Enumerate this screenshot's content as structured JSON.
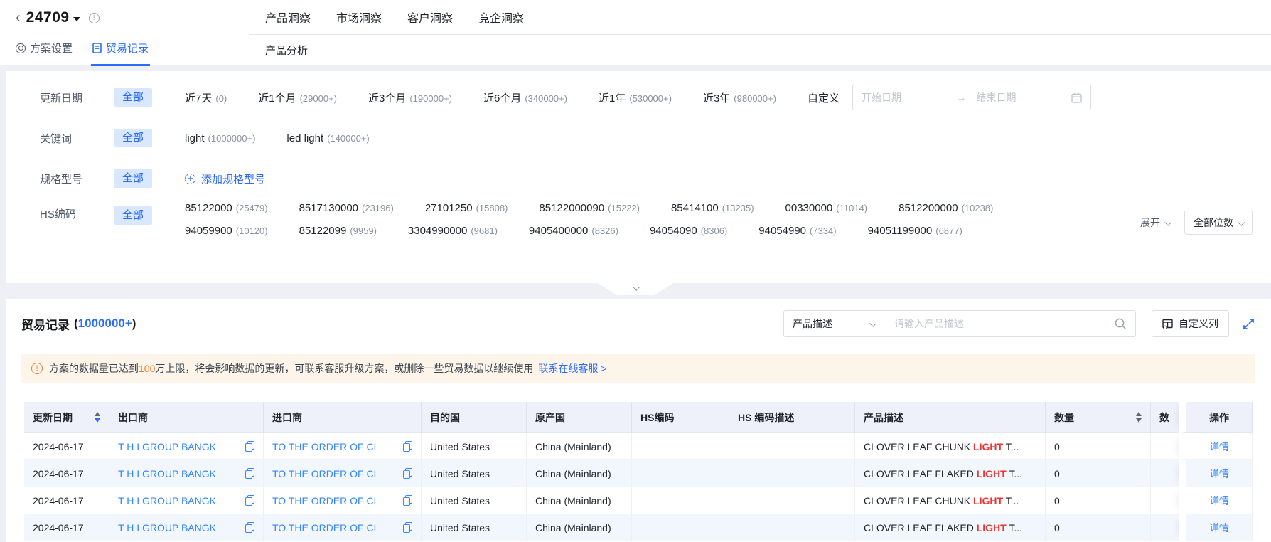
{
  "header": {
    "back_icon": "‹",
    "plan_id": "24709",
    "tabs": [
      {
        "label": "方案设置"
      },
      {
        "label": "贸易记录"
      }
    ],
    "nav": [
      "产品洞察",
      "市场洞察",
      "客户洞察",
      "竞企洞察"
    ],
    "subnav": "产品分析"
  },
  "filter": {
    "date": {
      "label": "更新日期",
      "all": "全部",
      "options": [
        {
          "name": "近7天",
          "count": "(0)"
        },
        {
          "name": "近1个月",
          "count": "(29000+)"
        },
        {
          "name": "近3个月",
          "count": "(190000+)"
        },
        {
          "name": "近6个月",
          "count": "(340000+)"
        },
        {
          "name": "近1年",
          "count": "(530000+)"
        },
        {
          "name": "近3年",
          "count": "(980000+)"
        }
      ],
      "custom": "自定义",
      "start_placeholder": "开始日期",
      "arrow": "→",
      "end_placeholder": "结束日期"
    },
    "keyword": {
      "label": "关键词",
      "all": "全部",
      "options": [
        {
          "name": "light",
          "count": "(1000000+)"
        },
        {
          "name": "led light",
          "count": "(140000+)"
        }
      ]
    },
    "spec": {
      "label": "规格型号",
      "all": "全部",
      "add": "添加规格型号"
    },
    "hs": {
      "label": "HS编码",
      "all": "全部",
      "line1": [
        {
          "name": "85122000",
          "count": "(25479)"
        },
        {
          "name": "8517130000",
          "count": "(23196)"
        },
        {
          "name": "27101250",
          "count": "(15808)"
        },
        {
          "name": "85122000090",
          "count": "(15222)"
        },
        {
          "name": "85414100",
          "count": "(13235)"
        },
        {
          "name": "00330000",
          "count": "(11014)"
        },
        {
          "name": "8512200000",
          "count": "(10238)"
        }
      ],
      "line2": [
        {
          "name": "94059900",
          "count": "(10120)"
        },
        {
          "name": "85122099",
          "count": "(9959)"
        },
        {
          "name": "3304990000",
          "count": "(9681)"
        },
        {
          "name": "9405400000",
          "count": "(8326)"
        },
        {
          "name": "94054090",
          "count": "(8306)"
        },
        {
          "name": "94054990",
          "count": "(7334)"
        },
        {
          "name": "94051199000",
          "count": "(6877)"
        }
      ],
      "expand": "展开",
      "digits": "全部位数"
    }
  },
  "records": {
    "title": "贸易记录",
    "count_prefix": "(",
    "count": "1000000+",
    "count_suffix": ")",
    "search_select": "产品描述",
    "search_placeholder": "请输入产品描述",
    "customize_columns": "自定义列"
  },
  "warning": {
    "pre": "方案的数据量已达到",
    "highlight": "100",
    "post": "万上限，将会影响数据的更新，可联系客服升级方案，或删除一些贸易数据以继续使用",
    "link": "联系在线客服 >"
  },
  "table": {
    "columns": [
      {
        "label": "更新日期",
        "sort": "desc"
      },
      {
        "label": "出口商"
      },
      {
        "label": "进口商"
      },
      {
        "label": "目的国"
      },
      {
        "label": "原产国"
      },
      {
        "label": "HS编码"
      },
      {
        "label": "HS 编码描述"
      },
      {
        "label": "产品描述"
      },
      {
        "label": "数量",
        "sort": "none"
      },
      {
        "label": "数"
      },
      {
        "label": "操作"
      }
    ],
    "rows": [
      {
        "date": "2024-06-17",
        "exporter": "T H I GROUP BANGK",
        "importer": "TO THE ORDER OF CL",
        "dest": "United States",
        "origin": "China (Mainland)",
        "hs": "",
        "hs_desc": "",
        "desc_pre": "CLOVER LEAF CHUNK ",
        "desc_hl": "LIGHT",
        "desc_post": " T...",
        "qty": "0",
        "qty2": "",
        "action": "详情"
      },
      {
        "date": "2024-06-17",
        "exporter": "T H I GROUP BANGK",
        "importer": "TO THE ORDER OF CL",
        "dest": "United States",
        "origin": "China (Mainland)",
        "hs": "",
        "hs_desc": "",
        "desc_pre": "CLOVER LEAF FLAKED ",
        "desc_hl": "LIGHT",
        "desc_post": " T...",
        "qty": "0",
        "qty2": "",
        "action": "详情"
      },
      {
        "date": "2024-06-17",
        "exporter": "T H I GROUP BANGK",
        "importer": "TO THE ORDER OF CL",
        "dest": "United States",
        "origin": "China (Mainland)",
        "hs": "",
        "hs_desc": "",
        "desc_pre": "CLOVER LEAF CHUNK ",
        "desc_hl": "LIGHT",
        "desc_post": " T...",
        "qty": "0",
        "qty2": "",
        "action": "详情"
      },
      {
        "date": "2024-06-17",
        "exporter": "T H I GROUP BANGK",
        "importer": "TO THE ORDER OF CL",
        "dest": "United States",
        "origin": "China (Mainland)",
        "hs": "",
        "hs_desc": "",
        "desc_pre": "CLOVER LEAF FLAKED ",
        "desc_hl": "LIGHT",
        "desc_post": " T...",
        "qty": "0",
        "qty2": "",
        "action": "详情"
      }
    ]
  },
  "colors": {
    "primary": "#2b6cff",
    "warning_orange": "#ed7b2f",
    "highlight_red": "#f23030"
  }
}
